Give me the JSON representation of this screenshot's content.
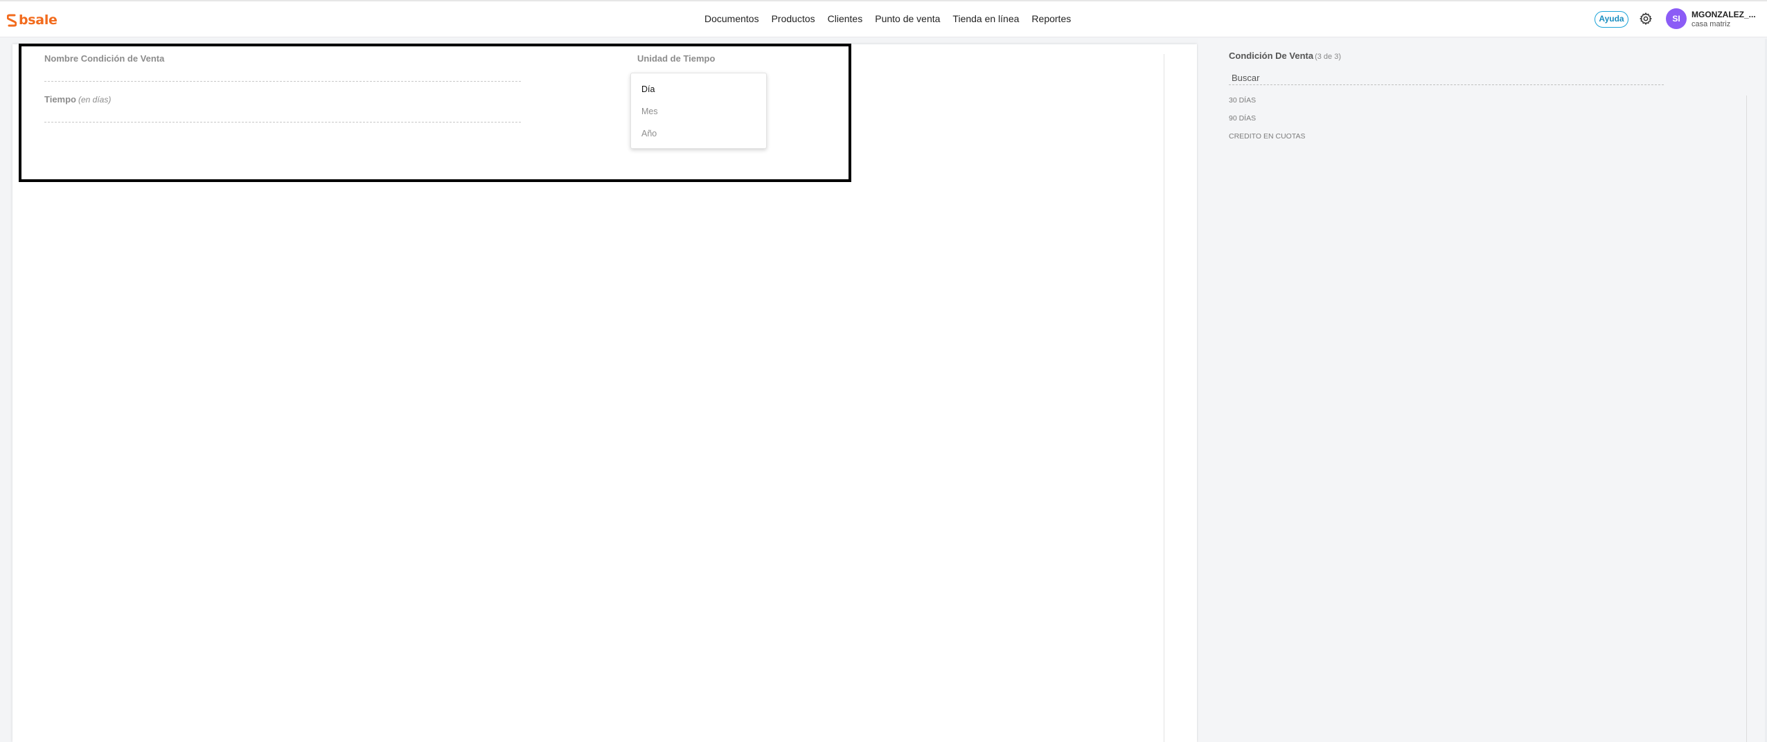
{
  "app": {
    "logo_text": "bsale",
    "brand_color": "#f26b1d"
  },
  "nav": {
    "items": [
      {
        "label": "Documentos"
      },
      {
        "label": "Productos"
      },
      {
        "label": "Clientes"
      },
      {
        "label": "Punto de venta"
      },
      {
        "label": "Tienda en línea"
      },
      {
        "label": "Reportes"
      }
    ]
  },
  "header": {
    "help_label": "Ayuda",
    "settings_icon": "gear-icon",
    "avatar_initials": "SI",
    "user_name": "MGONZALEZ_...",
    "user_branch": "casa matriz"
  },
  "form": {
    "name_label": "Nombre Condición de Venta",
    "name_value": "",
    "time_label": "Tiempo",
    "time_hint": "(en días)",
    "time_value": "",
    "unit_label": "Unidad de Tiempo",
    "unit_options": [
      {
        "label": "Día",
        "selected": true
      },
      {
        "label": "Mes",
        "selected": false
      },
      {
        "label": "Año",
        "selected": false
      }
    ]
  },
  "sidebar": {
    "title": "Condición De Venta",
    "count": "(3 de 3)",
    "search_placeholder": "Buscar",
    "items": [
      {
        "label": "30 DÍAS"
      },
      {
        "label": "90 DÍAS"
      },
      {
        "label": "CREDITO EN CUOTAS"
      }
    ]
  }
}
